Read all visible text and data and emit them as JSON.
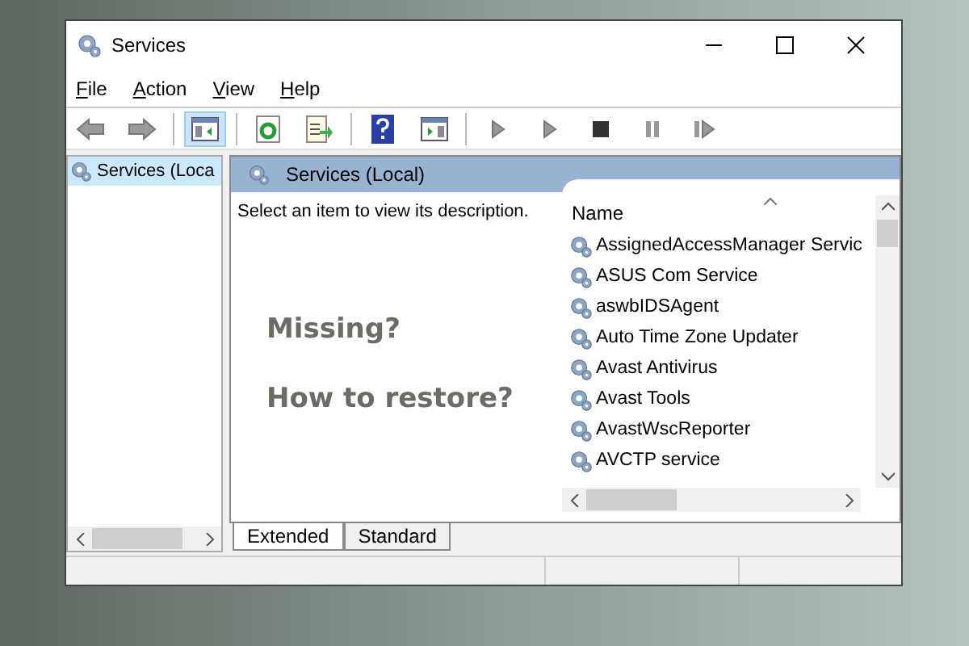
{
  "window": {
    "title": "Services"
  },
  "menu": [
    "File",
    "Action",
    "View",
    "Help"
  ],
  "toolbar": [
    {
      "kind": "back",
      "selected": false
    },
    {
      "kind": "forward",
      "selected": false
    },
    {
      "kind": "sep"
    },
    {
      "kind": "tree",
      "selected": true
    },
    {
      "kind": "sep"
    },
    {
      "kind": "refresh",
      "selected": false
    },
    {
      "kind": "export",
      "selected": false
    },
    {
      "kind": "sep"
    },
    {
      "kind": "help",
      "selected": false
    },
    {
      "kind": "pane",
      "selected": false
    },
    {
      "kind": "sep"
    },
    {
      "kind": "play",
      "selected": false
    },
    {
      "kind": "play",
      "selected": false
    },
    {
      "kind": "stop",
      "selected": false
    },
    {
      "kind": "pause",
      "selected": false
    },
    {
      "kind": "resume",
      "selected": false
    }
  ],
  "tree": [
    {
      "label": "Services (Loca",
      "selected": true
    }
  ],
  "panel": {
    "title": "Services (Local)",
    "description": "Select an item to view its description.",
    "overlay": [
      "Missing?",
      "How to restore?"
    ],
    "column": "Name",
    "rows": [
      "AssignedAccessManager Servic",
      "ASUS Com Service",
      "aswbIDSAgent",
      "Auto Time Zone Updater",
      "Avast Antivirus",
      "Avast Tools",
      "AvastWscReporter",
      "AVCTP service"
    ]
  },
  "tabs": [
    {
      "label": "Extended",
      "selected": true
    },
    {
      "label": "Standard",
      "selected": false
    }
  ]
}
